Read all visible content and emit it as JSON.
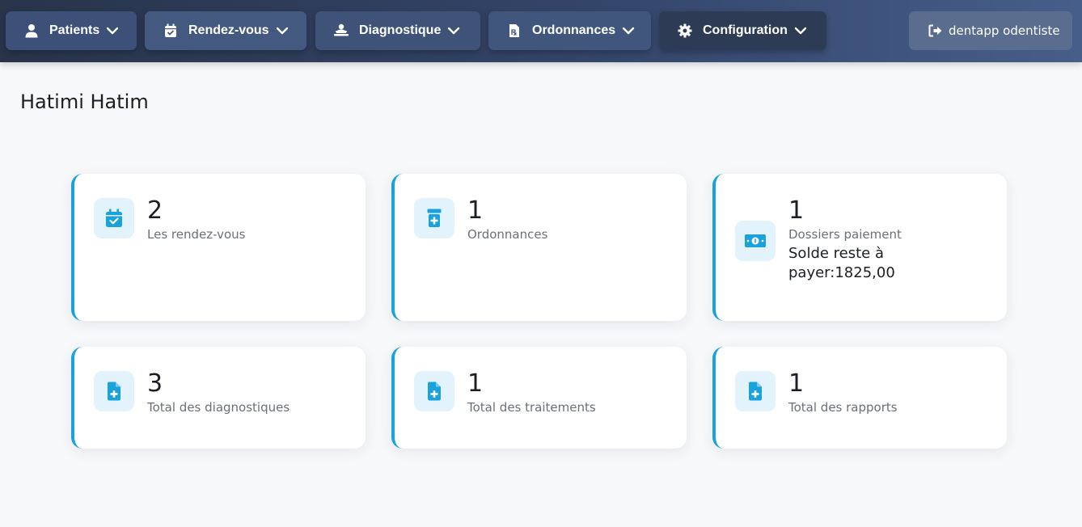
{
  "nav": {
    "patients": "Patients",
    "rendezvous": "Rendez-vous",
    "diagnostique": "Diagnostique",
    "ordonnances": "Ordonnances",
    "configuration": "Configuration",
    "user": "dentapp odentiste"
  },
  "page": {
    "title": "Hatimi Hatim"
  },
  "cards": [
    {
      "icon": "calendar-check-icon",
      "value": "2",
      "label": "Les rendez-vous"
    },
    {
      "icon": "prescription-bottle-icon",
      "value": "1",
      "label": "Ordonnances"
    },
    {
      "icon": "money-bill-icon",
      "value": "1",
      "label": "Dossiers paiement",
      "extra": "Solde reste à payer:1825,00"
    },
    {
      "icon": "file-medical-icon",
      "value": "3",
      "label": "Total des diagnostiques"
    },
    {
      "icon": "file-medical-icon",
      "value": "1",
      "label": "Total des traitements"
    },
    {
      "icon": "file-medical-icon",
      "value": "1",
      "label": "Total des rapports"
    }
  ],
  "colors": {
    "accent": "#1aa2dc",
    "icon_bg": "#e2f3fc",
    "nav_bg": "#34456a"
  }
}
